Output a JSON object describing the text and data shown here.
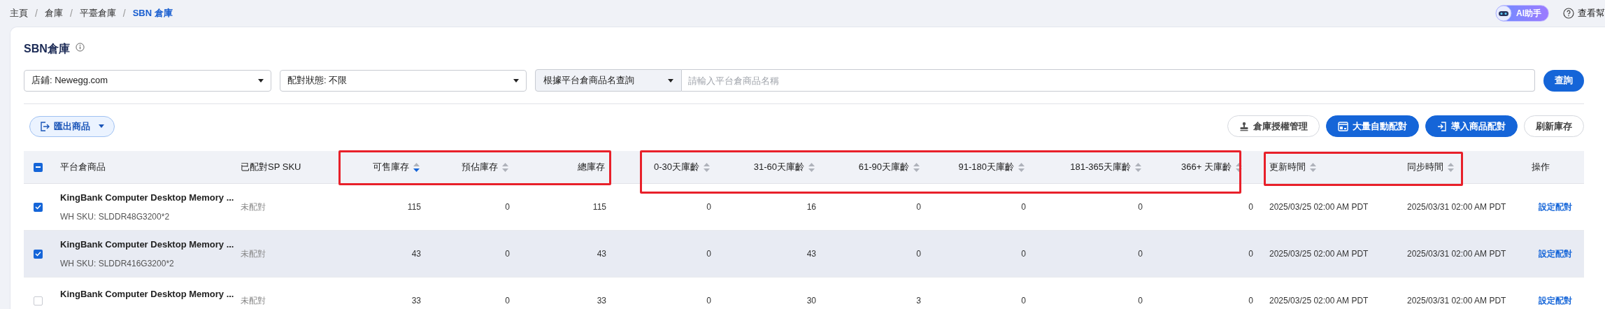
{
  "breadcrumbs": [
    {
      "kind": "link",
      "label": "主頁",
      "current": false
    },
    {
      "kind": "separator",
      "label": "/"
    },
    {
      "kind": "link",
      "label": "倉庫",
      "current": false
    },
    {
      "kind": "separator",
      "label": "/"
    },
    {
      "kind": "link",
      "label": "平臺倉庫",
      "current": false
    },
    {
      "kind": "separator",
      "label": "/"
    },
    {
      "kind": "link",
      "label": "SBN 倉庫",
      "current": true
    }
  ],
  "header_actions": {
    "assistant": "AI助手",
    "help": "查看幫"
  },
  "page_title": "SBN倉庫",
  "filters": {
    "store": "店鋪: Newegg.com",
    "match_status": "配對狀態: 不限",
    "search_mode": "根據平台倉商品名查詢",
    "search": {
      "placeholder": "請輸入平台倉商品名稱"
    },
    "search_button": "查詢"
  },
  "toolbar": {
    "export": "匯出商品",
    "buttons": [
      {
        "label": "倉庫授權管理",
        "kind": "outline"
      },
      {
        "label": "大量自動配對",
        "kind": "primary"
      },
      {
        "label": "導入商品配對",
        "kind": "primary"
      },
      {
        "label": "刷新庫存",
        "kind": "outline"
      }
    ]
  },
  "table": {
    "select_all": {
      "indeterminate": true
    },
    "columns": [
      {
        "label": "平台倉商品"
      },
      {
        "label": "已配對SP SKU"
      },
      {
        "label": "可售庫存",
        "sorted": true
      },
      {
        "label": "預佔庫存",
        "sorted": false
      },
      {
        "label": "總庫存"
      },
      {
        "label": "0-30天庫齡",
        "sorted": false
      },
      {
        "label": "31-60天庫齡",
        "sorted": false
      },
      {
        "label": "61-90天庫齡",
        "sorted": false
      },
      {
        "label": "91-180天庫齡",
        "sorted": false
      },
      {
        "label": "181-365天庫齡",
        "sorted": false
      },
      {
        "label": "366+ 天庫齡",
        "sorted": false
      },
      {
        "label": "更新時間",
        "sorted": false
      },
      {
        "label": "同步時間",
        "sorted": false
      },
      {
        "label": "操作"
      }
    ],
    "rows": [
      {
        "checked": true,
        "hovered": false,
        "name": "KingBank Computer Desktop Memory ...",
        "sku": "WH SKU: SLDDR48G3200*2",
        "sp_sku": "未配對",
        "values": [
          "115",
          "0",
          "115",
          "0",
          "16",
          "0",
          "0",
          "0",
          "0"
        ],
        "updated": "2025/03/25 02:00 AM PDT",
        "synced": "2025/03/31 02:00 AM PDT",
        "action": "設定配對"
      },
      {
        "checked": true,
        "hovered": true,
        "name": "KingBank Computer Desktop Memory ...",
        "sku": "WH SKU: SLDDR416G3200*2",
        "sp_sku": "未配對",
        "values": [
          "43",
          "0",
          "43",
          "0",
          "43",
          "0",
          "0",
          "0",
          "0"
        ],
        "updated": "2025/03/25 02:00 AM PDT",
        "synced": "2025/03/31 02:00 AM PDT",
        "action": "設定配對"
      },
      {
        "checked": false,
        "hovered": false,
        "name": "KingBank Computer Desktop Memory ...",
        "sp_sku": "未配對",
        "values": [
          "33",
          "0",
          "33",
          "0",
          "30",
          "3",
          "0",
          "0",
          "0"
        ],
        "updated": "2025/03/25 02:00 AM PDT",
        "synced": "2025/03/31 02:00 AM PDT",
        "action": "設定配對"
      }
    ]
  }
}
